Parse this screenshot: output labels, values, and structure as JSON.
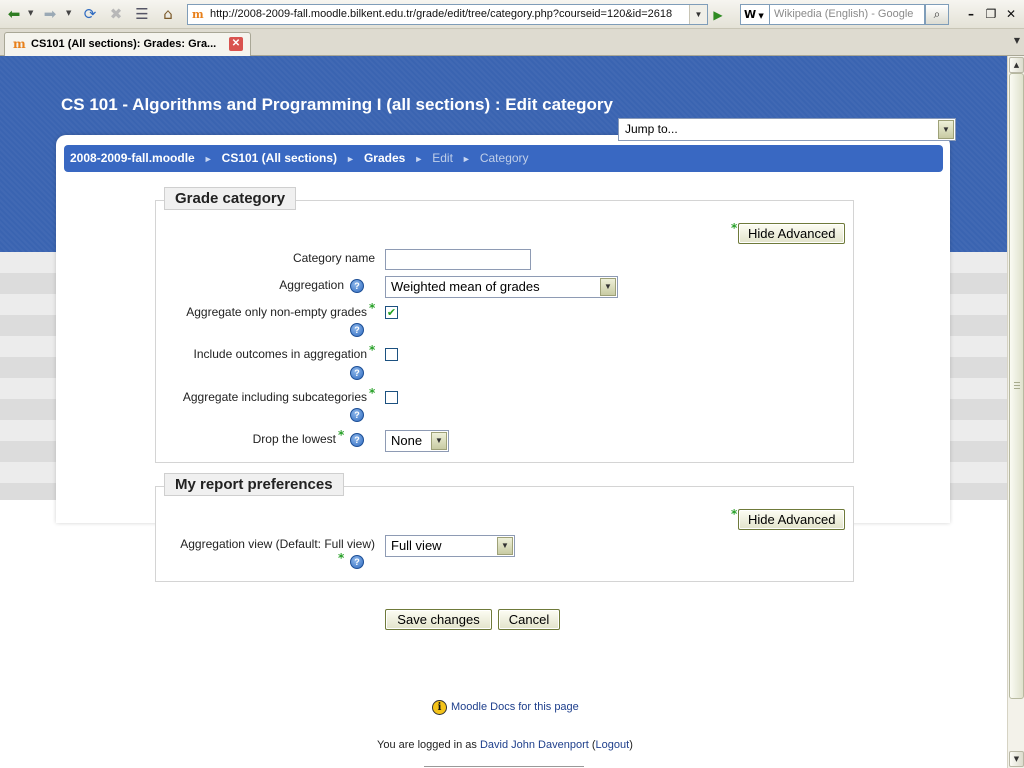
{
  "browser": {
    "url": "http://2008-2009-fall.moodle.bilkent.edu.tr/grade/edit/tree/category.php?courseid=120&id=2618",
    "search_engine_label": "W",
    "search_placeholder": "Wikipedia (English) - Google",
    "tab_title": "CS101 (All sections): Grades: Gra...",
    "favicon_text": "m"
  },
  "page": {
    "title": "CS 101 - Algorithms and Programming I (all sections) : Edit category",
    "jump_to": "Jump to..."
  },
  "breadcrumb": {
    "items": [
      "2008-2009-fall.moodle",
      "CS101 (All sections)",
      "Grades",
      "Edit",
      "Category"
    ],
    "separator": "►"
  },
  "grade_category": {
    "legend": "Grade category",
    "hide_advanced": "Hide Advanced",
    "category_name_label": "Category name",
    "category_name_value": "",
    "aggregation_label": "Aggregation",
    "aggregation_value": "Weighted mean of grades",
    "aggregate_nonempty_label": "Aggregate only non-empty grades",
    "aggregate_nonempty_checked": true,
    "include_outcomes_label": "Include outcomes in aggregation",
    "include_outcomes_checked": false,
    "aggregate_subcategories_label": "Aggregate including subcategories",
    "aggregate_subcategories_checked": false,
    "drop_lowest_label": "Drop the lowest",
    "drop_lowest_value": "None"
  },
  "report_preferences": {
    "legend": "My report preferences",
    "hide_advanced": "Hide Advanced",
    "aggregation_view_label": "Aggregation view (Default: Full view)",
    "aggregation_view_value": "Full view"
  },
  "actions": {
    "save": "Save changes",
    "cancel": "Cancel"
  },
  "footer": {
    "docs_link": "Moodle Docs for this page",
    "logged_in_prefix": "You are logged in as",
    "user_name": "David John Davenport",
    "logout": "Logout"
  },
  "icons": {
    "help": "?",
    "required": "*",
    "checkmark": "✔",
    "info": "i"
  }
}
